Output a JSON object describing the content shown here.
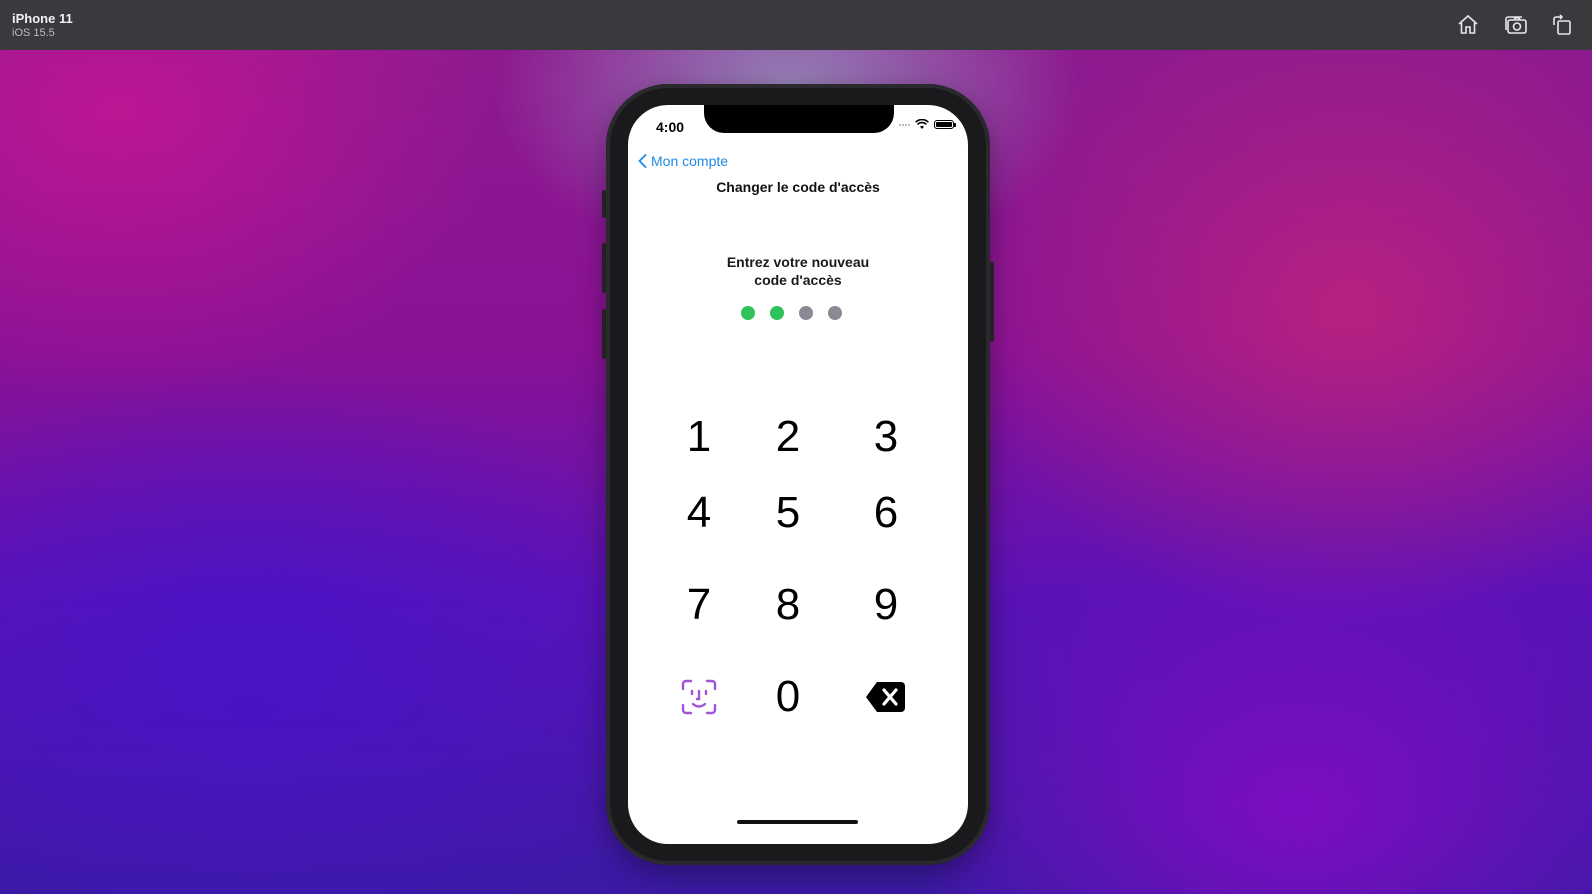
{
  "simulator": {
    "device_name": "iPhone 11",
    "os_version": "iOS 15.5",
    "toolbar_icons": [
      "home-icon",
      "screenshot-icon",
      "rotate-icon"
    ]
  },
  "status_bar": {
    "time": "4:00"
  },
  "nav": {
    "back_label": "Mon compte",
    "title": "Changer le code d'accès"
  },
  "passcode": {
    "prompt_line1": "Entrez votre nouveau",
    "prompt_line2": "code d'accès",
    "length": 4,
    "entered": 2,
    "filled_color": "#30c25a",
    "empty_color": "#8a8a94"
  },
  "keypad": {
    "keys": [
      "1",
      "2",
      "3",
      "4",
      "5",
      "6",
      "7",
      "8",
      "9",
      "0"
    ],
    "face_id_icon": "face-id-icon",
    "delete_icon": "delete-icon",
    "face_id_color": "#a054d8"
  }
}
